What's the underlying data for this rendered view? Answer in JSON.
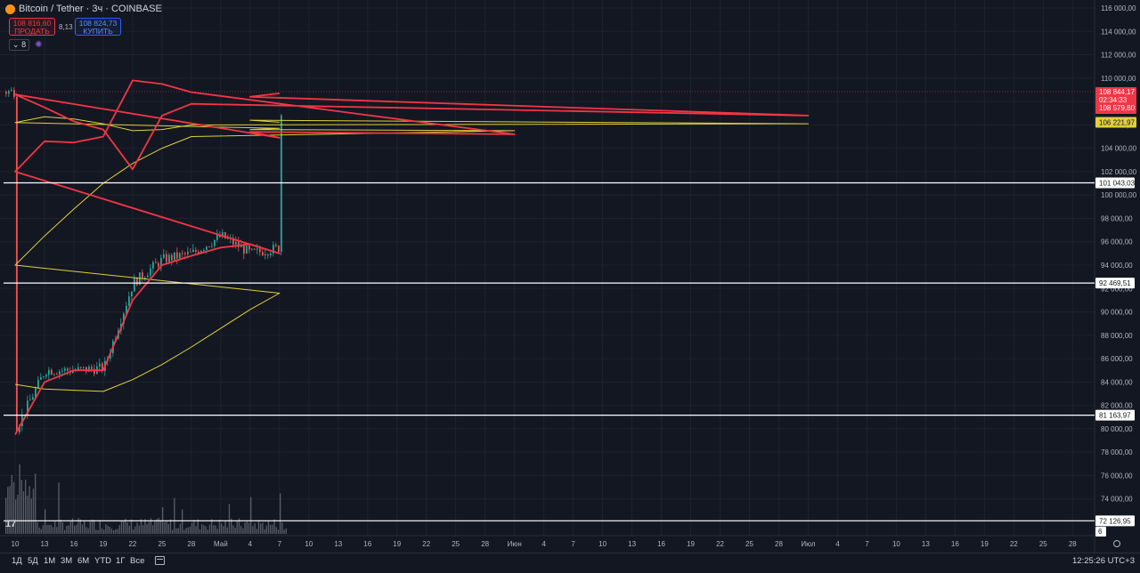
{
  "header": {
    "title": "Bitcoin / Tether · 3ч · COINBASE",
    "sell_price": "108 816,60",
    "sell_label": "ПРОДАТЬ",
    "spread": "8,13",
    "buy_price": "108 824,73",
    "buy_label": "КУПИТЬ",
    "indicator_count": "8"
  },
  "bottom_bar": {
    "timeframes": [
      "1Д",
      "5Д",
      "1М",
      "3М",
      "6М",
      "YTD",
      "1Г",
      "Все"
    ],
    "clock": "12:25:26 UTC+3"
  },
  "colors": {
    "background": "#131722",
    "up_candle": "#26a69a",
    "down_candle": "#ef5350",
    "ema_fast": "#f23645",
    "ma_slow": "#e0d03a",
    "level_line": "#ffffff",
    "price_label": "#f23645"
  },
  "price_axis": {
    "labels": [
      "116 000,00",
      "114 000,00",
      "112 000,00",
      "110 000,00",
      "108 000,00",
      "106 000,00",
      "104 000,00",
      "102 000,00",
      "100 000,00",
      "98 000,00",
      "96 000,00",
      "94 000,00",
      "92 000,00",
      "90 000,00",
      "88 000,00",
      "86 000,00",
      "84 000,00",
      "82 000,00",
      "80 000,00",
      "78 000,00",
      "76 000,00",
      "74 000,00",
      "72 000,00"
    ],
    "current_price": "108 844,17",
    "countdown": "02:34:33",
    "prev_price": "108 579,80",
    "ma_value": "106 221,97",
    "bottom_value": "6"
  },
  "time_axis": {
    "labels": [
      "10",
      "13",
      "16",
      "19",
      "22",
      "25",
      "28",
      "Май",
      "4",
      "7",
      "10",
      "13",
      "16",
      "19",
      "22",
      "25",
      "28",
      "Июн",
      "4",
      "7",
      "10",
      "13",
      "16",
      "19",
      "22",
      "25",
      "28",
      "Июл",
      "4",
      "7",
      "10",
      "13",
      "16",
      "19",
      "22",
      "25",
      "28"
    ]
  },
  "horizontal_levels": [
    {
      "price": 101043.03,
      "label": "101 043,03"
    },
    {
      "price": 92469.51,
      "label": "92 469,51"
    },
    {
      "price": 81163.97,
      "label": "81 163,97"
    },
    {
      "price": 72126.95,
      "label": "72 126,95"
    }
  ],
  "chart_data": {
    "type": "line",
    "ylim": [
      71000,
      116600
    ],
    "price_path": {
      "x": [
        "10",
        "13",
        "16",
        "19",
        "22",
        "25",
        "28",
        "Май",
        "4",
        "7",
        "10",
        "13",
        "16",
        "19",
        "22",
        "25",
        "28",
        "Июн",
        "4",
        "7",
        "10",
        "13",
        "16",
        "19",
        "22",
        "25",
        "28",
        "Июл",
        "4",
        "7"
      ],
      "y": [
        80000,
        85000,
        85000,
        85200,
        92500,
        94500,
        95000,
        96500,
        95000,
        95500,
        105000,
        104500,
        104000,
        105500,
        111500,
        110000,
        108000,
        104000,
        105200,
        104800,
        109000,
        106000,
        106500,
        105000,
        102500,
        107500,
        107500,
        106200,
        108700,
        108844
      ]
    },
    "ema_fast": {
      "x": [
        "10",
        "13",
        "16",
        "19",
        "22",
        "25",
        "28",
        "Май",
        "4",
        "7",
        "10",
        "13",
        "16",
        "19",
        "22",
        "25",
        "28",
        "Июн",
        "4",
        "7",
        "10",
        "13",
        "16",
        "19",
        "22",
        "25",
        "28",
        "Июл",
        "4",
        "7"
      ],
      "y": [
        79500,
        84000,
        85000,
        85000,
        91000,
        94000,
        94800,
        95500,
        95800,
        95000,
        102000,
        104600,
        104500,
        105000,
        109800,
        109500,
        108800,
        105200,
        105400,
        104900,
        108600,
        107500,
        106300,
        105600,
        102200,
        106800,
        107800,
        106800,
        108400,
        108700
      ]
    },
    "ma_slow": {
      "x": [
        "10",
        "13",
        "16",
        "19",
        "22",
        "25",
        "28",
        "Май",
        "4",
        "7",
        "10",
        "13",
        "16",
        "19",
        "22",
        "25",
        "28",
        "Июн",
        "4",
        "7",
        "10",
        "13",
        "16",
        "19",
        "22",
        "25",
        "28",
        "Июл",
        "4",
        "7"
      ],
      "y": [
        83800,
        83400,
        83300,
        83200,
        84200,
        85500,
        87000,
        88600,
        90200,
        91600,
        94000,
        96500,
        98800,
        101000,
        102700,
        104000,
        105000,
        105500,
        105600,
        105700,
        106200,
        106700,
        106500,
        106100,
        105500,
        105600,
        106000,
        106100,
        106400,
        106222
      ]
    }
  }
}
